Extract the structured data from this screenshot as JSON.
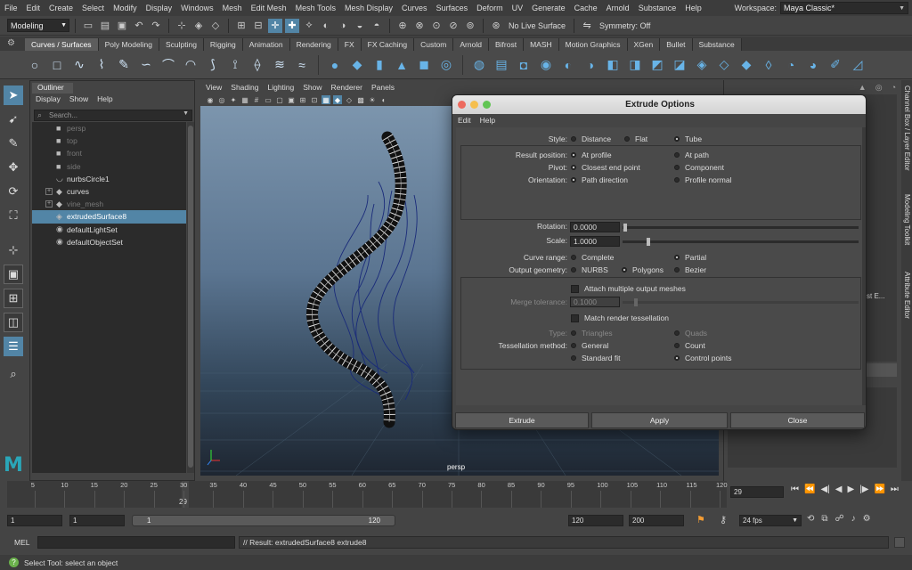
{
  "menubar": {
    "items": [
      "File",
      "Edit",
      "Create",
      "Select",
      "Modify",
      "Display",
      "Windows",
      "Mesh",
      "Edit Mesh",
      "Mesh Tools",
      "Mesh Display",
      "Curves",
      "Surfaces",
      "Deform",
      "UV",
      "Generate",
      "Cache",
      "Arnold",
      "Substance",
      "Help"
    ],
    "workspace_label": "Workspace:",
    "workspace_value": "Maya Classic*"
  },
  "statusline": {
    "mode": "Modeling",
    "live_surface": "No Live Surface",
    "symmetry": "Symmetry: Off"
  },
  "shelf": {
    "tabs": [
      "Curves / Surfaces",
      "Poly Modeling",
      "Sculpting",
      "Rigging",
      "Animation",
      "Rendering",
      "FX",
      "FX Caching",
      "Custom",
      "Arnold",
      "Bifrost",
      "MASH",
      "Motion Graphics",
      "XGen",
      "Bullet",
      "Substance"
    ],
    "active_tab": "Curves / Surfaces"
  },
  "outliner": {
    "tab": "Outliner",
    "menu": [
      "Display",
      "Show",
      "Help"
    ],
    "search_placeholder": "Search...",
    "rows": [
      {
        "label": "persp",
        "icon": "camera-icon",
        "dim": true,
        "expand": false,
        "selected": false
      },
      {
        "label": "top",
        "icon": "camera-icon",
        "dim": true,
        "expand": false,
        "selected": false
      },
      {
        "label": "front",
        "icon": "camera-icon",
        "dim": true,
        "expand": false,
        "selected": false
      },
      {
        "label": "side",
        "icon": "camera-icon",
        "dim": true,
        "expand": false,
        "selected": false
      },
      {
        "label": "nurbsCircle1",
        "icon": "curve-icon",
        "dim": false,
        "expand": false,
        "selected": false
      },
      {
        "label": "curves",
        "icon": "group-icon",
        "dim": false,
        "expand": true,
        "selected": false
      },
      {
        "label": "vine_mesh",
        "icon": "group-icon",
        "dim": true,
        "expand": true,
        "selected": false
      },
      {
        "label": "extrudedSurface8",
        "icon": "surface-icon",
        "dim": false,
        "expand": false,
        "selected": true
      },
      {
        "label": "defaultLightSet",
        "icon": "set-icon",
        "dim": false,
        "expand": false,
        "selected": false
      },
      {
        "label": "defaultObjectSet",
        "icon": "set-icon",
        "dim": false,
        "expand": false,
        "selected": false
      }
    ]
  },
  "viewport": {
    "menu": [
      "View",
      "Shading",
      "Lighting",
      "Show",
      "Renderer",
      "Panels"
    ],
    "camera_label": "persp"
  },
  "dialog": {
    "title": "Extrude Options",
    "menu": [
      "Edit",
      "Help"
    ],
    "style_label": "Style:",
    "style_options": [
      "Distance",
      "Flat",
      "Tube"
    ],
    "style_selected": "Tube",
    "result_position_label": "Result position:",
    "result_position_options": [
      "At profile",
      "At path"
    ],
    "result_position_selected": "At profile",
    "pivot_label": "Pivot:",
    "pivot_options": [
      "Closest end point",
      "Component"
    ],
    "pivot_selected": "Closest end point",
    "orientation_label": "Orientation:",
    "orientation_options": [
      "Path direction",
      "Profile normal"
    ],
    "orientation_selected": "Path direction",
    "rotation_label": "Rotation:",
    "rotation_value": "0.0000",
    "scale_label": "Scale:",
    "scale_value": "1.0000",
    "curve_range_label": "Curve range:",
    "curve_range_options": [
      "Complete",
      "Partial"
    ],
    "curve_range_selected": "Partial",
    "output_geometry_label": "Output geometry:",
    "output_geometry_options": [
      "NURBS",
      "Polygons",
      "Bezier"
    ],
    "output_geometry_selected": "Polygons",
    "attach_label": "Attach multiple output meshes",
    "merge_tolerance_label": "Merge tolerance:",
    "merge_tolerance_value": "0.1000",
    "match_render_label": "Match render tessellation",
    "type_label": "Type:",
    "type_options": [
      "Triangles",
      "Quads"
    ],
    "tessellation_label": "Tessellation method:",
    "tessellation_options": [
      "General",
      "Count",
      "Standard fit",
      "Control points"
    ],
    "tessellation_selected": "Control points",
    "buttons": {
      "extrude": "Extrude",
      "apply": "Apply",
      "close": "Close"
    }
  },
  "right_panel": {
    "vertical_tabs": [
      "Channel Box / Layer Editor",
      "Modeling Toolkit",
      "Attribute Editor"
    ],
    "truncated_text": "st E..."
  },
  "timeline": {
    "ticks": [
      "5",
      "10",
      "15",
      "20",
      "25",
      "30",
      "35",
      "40",
      "45",
      "50",
      "55",
      "60",
      "65",
      "70",
      "75",
      "80",
      "85",
      "90",
      "95",
      "100",
      "105",
      "110",
      "115",
      "120"
    ],
    "current_frame_label": "29",
    "current_frame_field": "29"
  },
  "range": {
    "start_field": "1",
    "playback_start": "1",
    "slider_start": "1",
    "slider_end": "120",
    "playback_end": "120",
    "end_field": "200",
    "fps": "24 fps"
  },
  "command": {
    "label": "MEL",
    "result": "// Result: extrudedSurface8 extrude8"
  },
  "helpline": {
    "text": "Select Tool: select an object"
  }
}
